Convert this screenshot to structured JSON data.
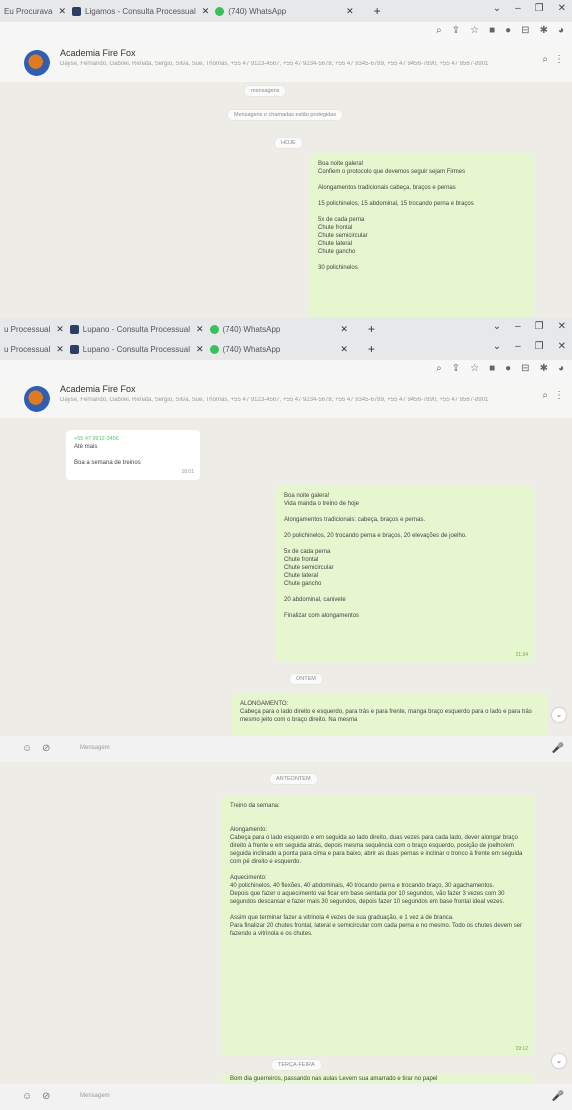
{
  "tabs": [
    {
      "label": "Eu Procurava"
    },
    {
      "label": "Ligamos - Consulta Processual"
    },
    {
      "label": "(740) WhatsApp"
    }
  ],
  "tabs_b": [
    {
      "label": "u Processual"
    },
    {
      "label": "Lupano - Consulta Processual"
    },
    {
      "label": "(740) WhatsApp"
    }
  ],
  "window_controls": {
    "min": "–",
    "max": "❐",
    "close": "✕"
  },
  "chat": {
    "name": "Academia Fire Fox",
    "members": "Dayse, Fernando, Gabriel, Renata, Sergio, Silva, Sue, Thomas, +55 47 9123-4567, +55 47 9234-5678, +55 47 9345-6789, +55 47 9456-7890, +55 47 9567-8901",
    "search_icon": "⌕",
    "menu_icon": "⋮"
  },
  "panel1": {
    "pills": [
      "mensagens",
      "Mensagens e chamadas estão protegidas",
      "HOJE"
    ],
    "bubble": "Boa noite galera!\nConfiem o protocolo que devemos seguir sejam Firmes\n\nAlongamentos tradicionais cabeça, braços e pernas\n\n15 polichinelos, 15 abdominal, 15 trocando perna e braços\n\n5x de cada perna\nChute frontal\nChute semicircular\nChute lateral\nChute gancho\n\n30 polichinelos"
  },
  "panel2": {
    "incoming_sender": "+55 47 9912-3456",
    "incoming_text": "Até mais",
    "incoming_reply": "Boa a semana de treinos",
    "incoming_time": "18:01",
    "bubble": "Boa noite galera!\nVida manda o treino de hoje\n\nAlongamentos tradicionais: cabeça, braços e pernas.\n\n20 polichinelos, 20 trocando perna e braços, 20 elevações de joelho.\n\n5x de cada perna\nChute frontal\nChute semicircular\nChute lateral\nChute gancho\n\n20 abdominal, canivete\n\nFinalizar com alongamentos",
    "bubble_time": "21:34",
    "pill": "ONTEM",
    "bubble2": "ALONGAMENTO:\nCabeça para o lado direito e esquerdo, para trás e para frente, manga braço esquerdo para o lado e para trás mesmo jeito com o braço direito. Na mesma"
  },
  "input": {
    "placeholder": "Mensagem",
    "emoji": "☺",
    "clip": "⊘",
    "mic": "🎤"
  },
  "panel3": {
    "pill": "ANTEONTEM",
    "bubble": "Treino da semana:\n\n\nAlongamento:\nCabeça para o lado esquerdo e em seguida ao lado direito, duas vezes para cada lado, dever alongar braço direito à frente e em seguida atrás, depois mesma sequência com o braço esquerdo, posição de joelho/em seguida inclinado a ponta para cima e para baixo, abrir as duas pernas e inclinar o tronco à frente em seguida com pé direito e esquerdo.\n\nAquecimento:\n40 polichinelos, 40 flexões, 40 abdominais, 40 trocando perna e trocando braço, 30 agachamentos.\nDepois que fazer o aquecimento vai ficar em base sentada por 10 segundos, vão fazer 3 vezes com 30 segundos descansar e fazer mais 30 segundos, depois fazer 10 segundos em base frontal ideal vezes.\n\nAssim que terminar fazer a vitrinola 4 vezes de sua graduação, e 1 vez a de branca.\nPara finalizar 20 chutes frontal, lateral e semicircular com cada perna e no mesmo. Todo os chutes devem ser fazendo a vitrinola e os chutes.",
    "bubble_time": "19:12",
    "pill2": "TERÇA-FEIRA",
    "bubble2": "Bom dia guerreiros, passando nas aulas Levem sua amarrado e tirar no papel"
  }
}
